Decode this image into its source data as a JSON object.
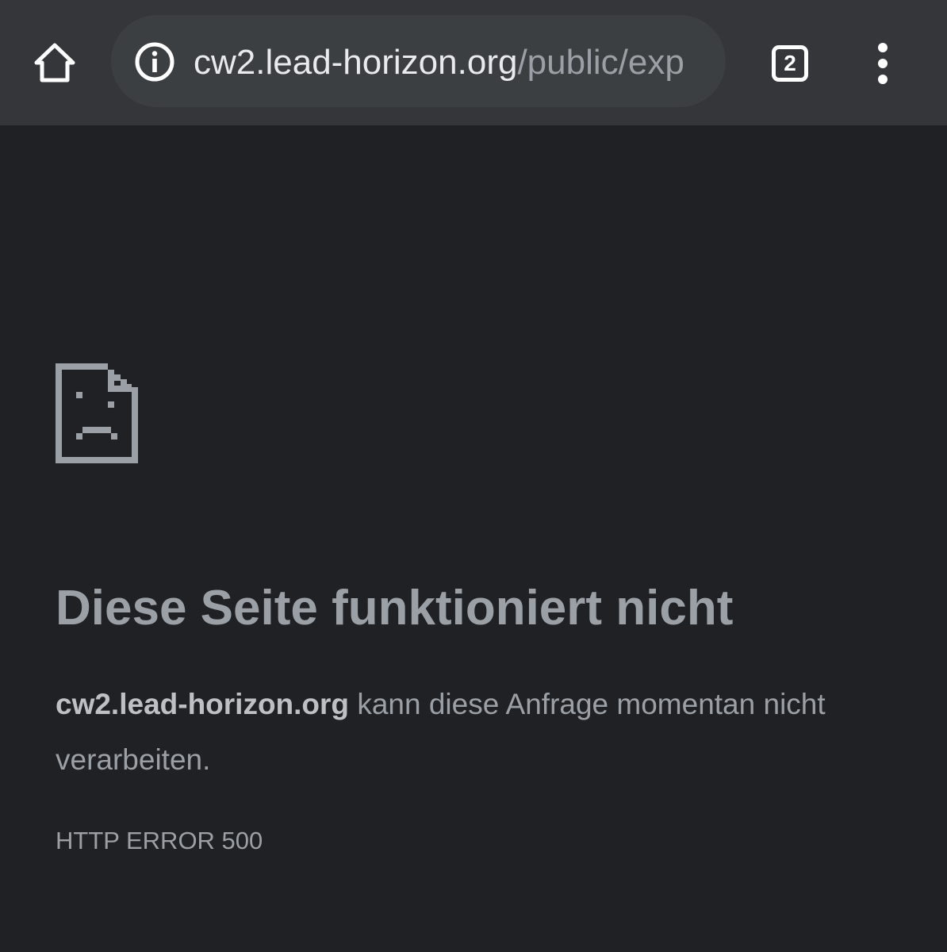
{
  "browser": {
    "url_host": "cw2.lead-horizon.org",
    "url_path": "/public/exp",
    "tab_count": "2",
    "icons": {
      "home": "home-icon",
      "info": "info-icon",
      "tabs": "tab-switcher-icon",
      "menu": "more-vert-icon"
    }
  },
  "error_page": {
    "icon": "sad-page-icon",
    "title": "Diese Seite funktioniert nicht",
    "message_host": "cw2.lead-horizon.org",
    "message_text": " kann diese Anfrage momentan nicht verarbeiten.",
    "error_code": "HTTP ERROR 500"
  },
  "colors": {
    "toolbar_bg": "#35363a",
    "omnibox_bg": "#3c3f41",
    "page_bg": "#202124",
    "text_secondary": "#9aa0a6"
  }
}
